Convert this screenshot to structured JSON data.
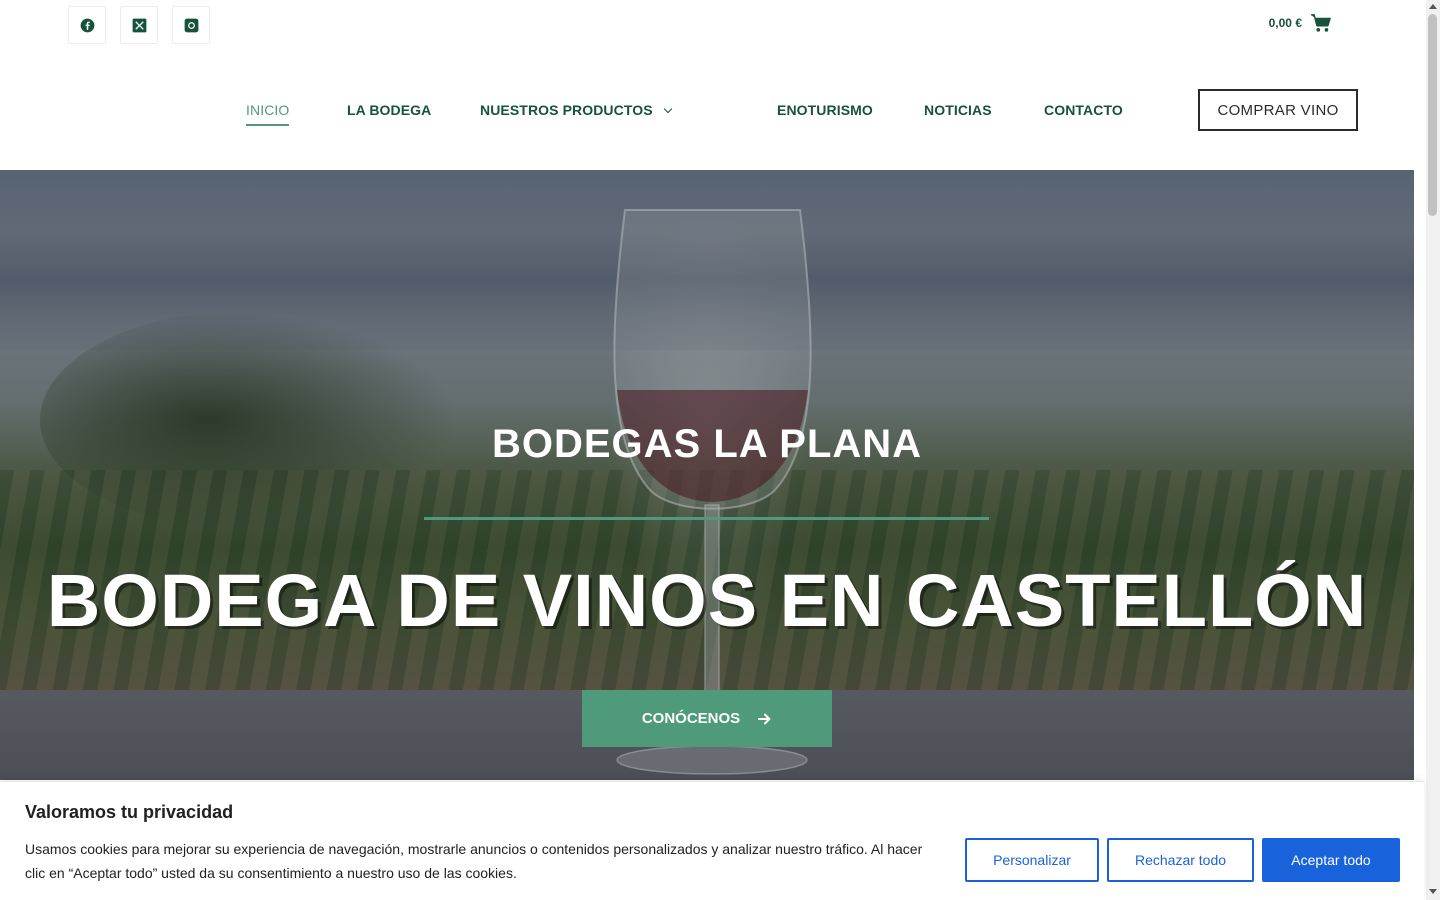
{
  "topbar": {
    "socials": [
      {
        "icon": "facebook-icon"
      },
      {
        "icon": "x-twitter-icon"
      },
      {
        "icon": "instagram-icon"
      }
    ],
    "cart_total": "0,00 €",
    "cart_icon": "cart-icon"
  },
  "nav": {
    "items": [
      {
        "label": "INICIO",
        "active": true
      },
      {
        "label": "LA BODEGA"
      },
      {
        "label": "NUESTROS PRODUCTOS",
        "has_dropdown": true
      },
      {
        "label": "ENOTURISMO"
      },
      {
        "label": "NOTICIAS"
      },
      {
        "label": "CONTACTO"
      }
    ],
    "buy_button": "COMPRAR VINO"
  },
  "hero": {
    "subtitle": "BODEGAS LA PLANA",
    "title": "BODEGA DE VINOS EN CASTELLÓN",
    "button_label": "CONÓCENOS",
    "button_icon": "arrow-right-icon"
  },
  "cookie": {
    "title": "Valoramos tu privacidad",
    "text": "Usamos cookies para mejorar su experiencia de navegación, mostrarle anuncios o contenidos personalizados y analizar nuestro tráfico. Al hacer clic en “Aceptar todo” usted da su consentimiento a nuestro uso de las cookies.",
    "customize": "Personalizar",
    "reject": "Rechazar todo",
    "accept": "Aceptar todo"
  },
  "colors": {
    "brand_dark_green": "#17523a",
    "accent_green": "#4f9a7b",
    "cookie_blue": "#1863dc"
  }
}
